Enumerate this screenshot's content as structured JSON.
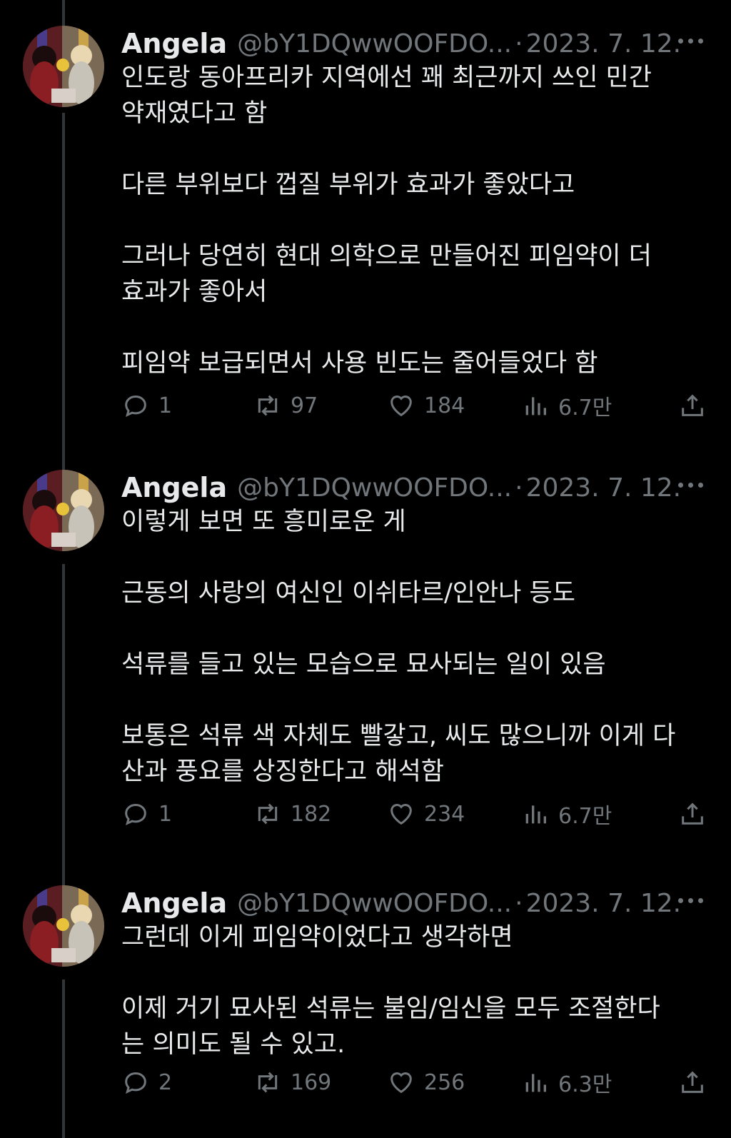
{
  "tweets": [
    {
      "name": "Angela",
      "handle": "@bY1DQwwOOFDO...",
      "separator": "·",
      "date": "2023. 7. 12.",
      "lines": [
        "인도랑 동아프리카 지역에선 꽤 최근까지 쓰인 민간",
        "약재였다고 함",
        "",
        "다른 부위보다 껍질 부위가 효과가 좋았다고",
        "",
        "그러나 당연히 현대 의학으로 만들어진 피임약이 더",
        "효과가 좋아서",
        "",
        "피임약 보급되면서 사용 빈도는 줄어들었다 함"
      ],
      "replies": "1",
      "retweets": "97",
      "likes": "184",
      "views": "6.7만"
    },
    {
      "name": "Angela",
      "handle": "@bY1DQwwOOFDO...",
      "separator": "·",
      "date": "2023. 7. 12.",
      "lines": [
        "이렇게 보면 또 흥미로운 게",
        "",
        "근동의 사랑의 여신인 이쉬타르/인안나 등도",
        "",
        "석류를 들고 있는 모습으로 묘사되는 일이 있음",
        "",
        "보통은 석류 색 자체도 빨갛고, 씨도 많으니까 이게 다",
        "산과 풍요를 상징한다고 해석함"
      ],
      "replies": "1",
      "retweets": "182",
      "likes": "234",
      "views": "6.7만"
    },
    {
      "name": "Angela",
      "handle": "@bY1DQwwOOFDO...",
      "separator": "·",
      "date": "2023. 7. 12.",
      "lines": [
        "그런데 이게 피임약이었다고 생각하면",
        "",
        "이제 거기 묘사된 석류는 불임/임신을 모두 조절한다",
        "는 의미도 될 수 있고."
      ],
      "replies": "2",
      "retweets": "169",
      "likes": "256",
      "views": "6.3만"
    }
  ],
  "icons": {
    "reply": "reply-icon",
    "retweet": "retweet-icon",
    "like": "like-icon",
    "views": "views-icon",
    "share": "share-icon",
    "more": "more-icon"
  },
  "colors": {
    "background": "#000000",
    "text": "#e7e9ea",
    "secondary": "#71767b",
    "thread_line": "#333639"
  }
}
